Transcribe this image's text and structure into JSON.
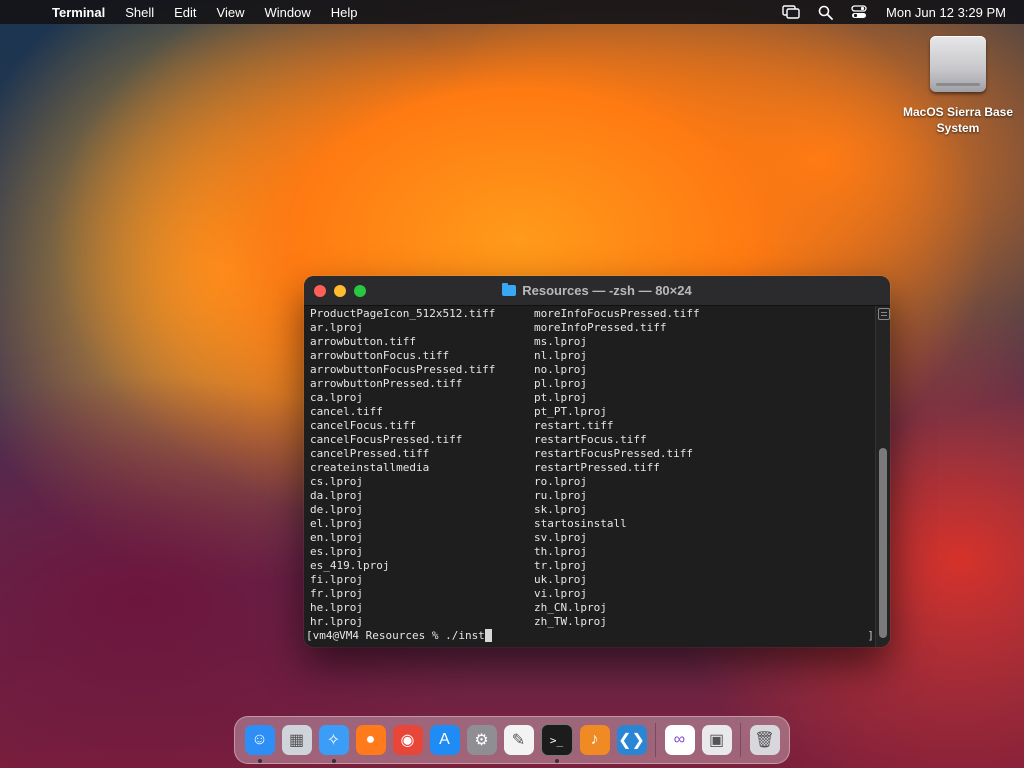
{
  "menubar": {
    "apple_glyph": "",
    "app_name": "Terminal",
    "items": [
      "Shell",
      "Edit",
      "View",
      "Window",
      "Help"
    ],
    "clock": "Mon Jun 12  3:29 PM"
  },
  "desktop": {
    "drive_label": "MacOS Sierra Base System"
  },
  "terminal": {
    "title": "Resources — -zsh — 80×24",
    "col1": [
      "ProductPageIcon_512x512.tiff",
      "ar.lproj",
      "arrowbutton.tiff",
      "arrowbuttonFocus.tiff",
      "arrowbuttonFocusPressed.tiff",
      "arrowbuttonPressed.tiff",
      "ca.lproj",
      "cancel.tiff",
      "cancelFocus.tiff",
      "cancelFocusPressed.tiff",
      "cancelPressed.tiff",
      "createinstallmedia",
      "cs.lproj",
      "da.lproj",
      "de.lproj",
      "el.lproj",
      "en.lproj",
      "es.lproj",
      "es_419.lproj",
      "fi.lproj",
      "fr.lproj",
      "he.lproj",
      "hr.lproj"
    ],
    "col2": [
      "moreInfoFocusPressed.tiff",
      "moreInfoPressed.tiff",
      "ms.lproj",
      "nl.lproj",
      "no.lproj",
      "pl.lproj",
      "pt.lproj",
      "pt_PT.lproj",
      "restart.tiff",
      "restartFocus.tiff",
      "restartFocusPressed.tiff",
      "restartPressed.tiff",
      "ro.lproj",
      "ru.lproj",
      "sk.lproj",
      "startosinstall",
      "sv.lproj",
      "th.lproj",
      "tr.lproj",
      "uk.lproj",
      "vi.lproj",
      "zh_CN.lproj",
      "zh_TW.lproj"
    ],
    "prompt": "[vm4@VM4 Resources % ./inst",
    "close_bracket": "]"
  },
  "dock": {
    "apps": [
      {
        "name": "finder-icon",
        "color": "#2d8ff5",
        "running": true
      },
      {
        "name": "launchpad-icon",
        "color": "#cfd3da",
        "running": false
      },
      {
        "name": "safari-icon",
        "color": "#3b9df6",
        "running": true
      },
      {
        "name": "firefox-icon",
        "color": "#ff7a1a",
        "running": false
      },
      {
        "name": "chrome-icon",
        "color": "#e9463a",
        "running": false
      },
      {
        "name": "app-store-icon",
        "color": "#1f8cf5",
        "running": false
      },
      {
        "name": "system-settings-icon",
        "color": "#8e8e93",
        "running": false
      },
      {
        "name": "textedit-icon",
        "color": "#f3f3f3",
        "running": false
      },
      {
        "name": "terminal-icon",
        "color": "#1c1c1c",
        "running": true
      },
      {
        "name": "garageband-icon",
        "color": "#f08a24",
        "running": false
      },
      {
        "name": "vscode-icon",
        "color": "#2a86d4",
        "running": false
      },
      {
        "name": "visual-studio-icon",
        "color": "#ffffff",
        "running": false
      },
      {
        "name": "installer-icon",
        "color": "#e9e9ec",
        "running": false
      },
      {
        "name": "trash-icon",
        "color": "#d8d8dc",
        "running": false
      }
    ]
  }
}
